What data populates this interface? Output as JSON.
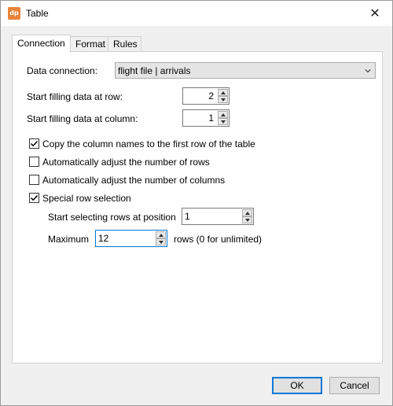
{
  "window": {
    "title": "Table",
    "app_icon_text": "dp",
    "close_glyph": "✕",
    "icon_color": "#e8833a"
  },
  "tabs": [
    {
      "label": "Connection",
      "active": true
    },
    {
      "label": "Format",
      "active": false
    },
    {
      "label": "Rules",
      "active": false
    }
  ],
  "connection": {
    "data_connection_label": "Data connection:",
    "data_connection_value": "flight file | arrivals",
    "start_row_label": "Start filling data at row:",
    "start_row_value": "2",
    "start_col_label": "Start filling data at column:",
    "start_col_value": "1",
    "options": [
      {
        "label": "Copy the column names to the first row of the table",
        "checked": true
      },
      {
        "label": "Automatically adjust the number of rows",
        "checked": false
      },
      {
        "label": "Automatically adjust the number of columns",
        "checked": false
      },
      {
        "label": "Special row selection",
        "checked": true
      }
    ],
    "start_position_label": "Start selecting rows at position",
    "start_position_value": "1",
    "maximum_label": "Maximum",
    "maximum_value": "12",
    "maximum_suffix": "rows (0 for unlimited)"
  },
  "buttons": {
    "ok": "OK",
    "cancel": "Cancel"
  },
  "colors": {
    "accent": "#0078d7"
  }
}
